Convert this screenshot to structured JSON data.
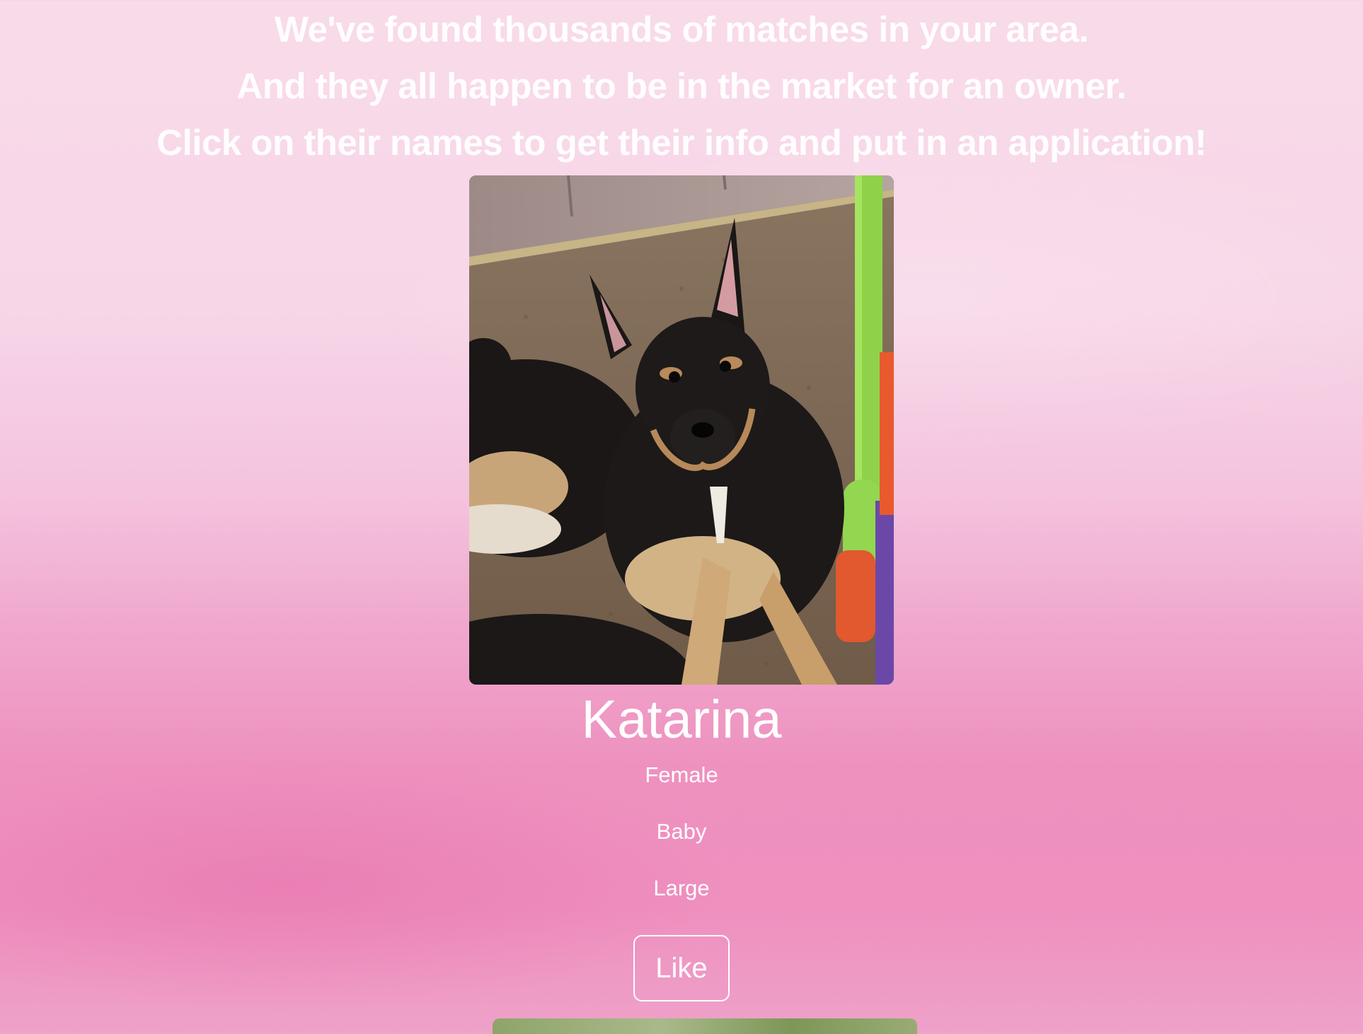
{
  "intro": {
    "line1": "We've found thousands of matches in your area.",
    "line2": "And they all happen to be in the market for an owner.",
    "line3": "Click on their names to get their info and put in an application!"
  },
  "pet": {
    "name": "Katarina",
    "gender": "Female",
    "age": "Baby",
    "size": "Large",
    "like_label": "Like"
  },
  "colors": {
    "background_top": "#f8dbe9",
    "background_bottom": "#ee91bf",
    "text": "#ffffff"
  }
}
